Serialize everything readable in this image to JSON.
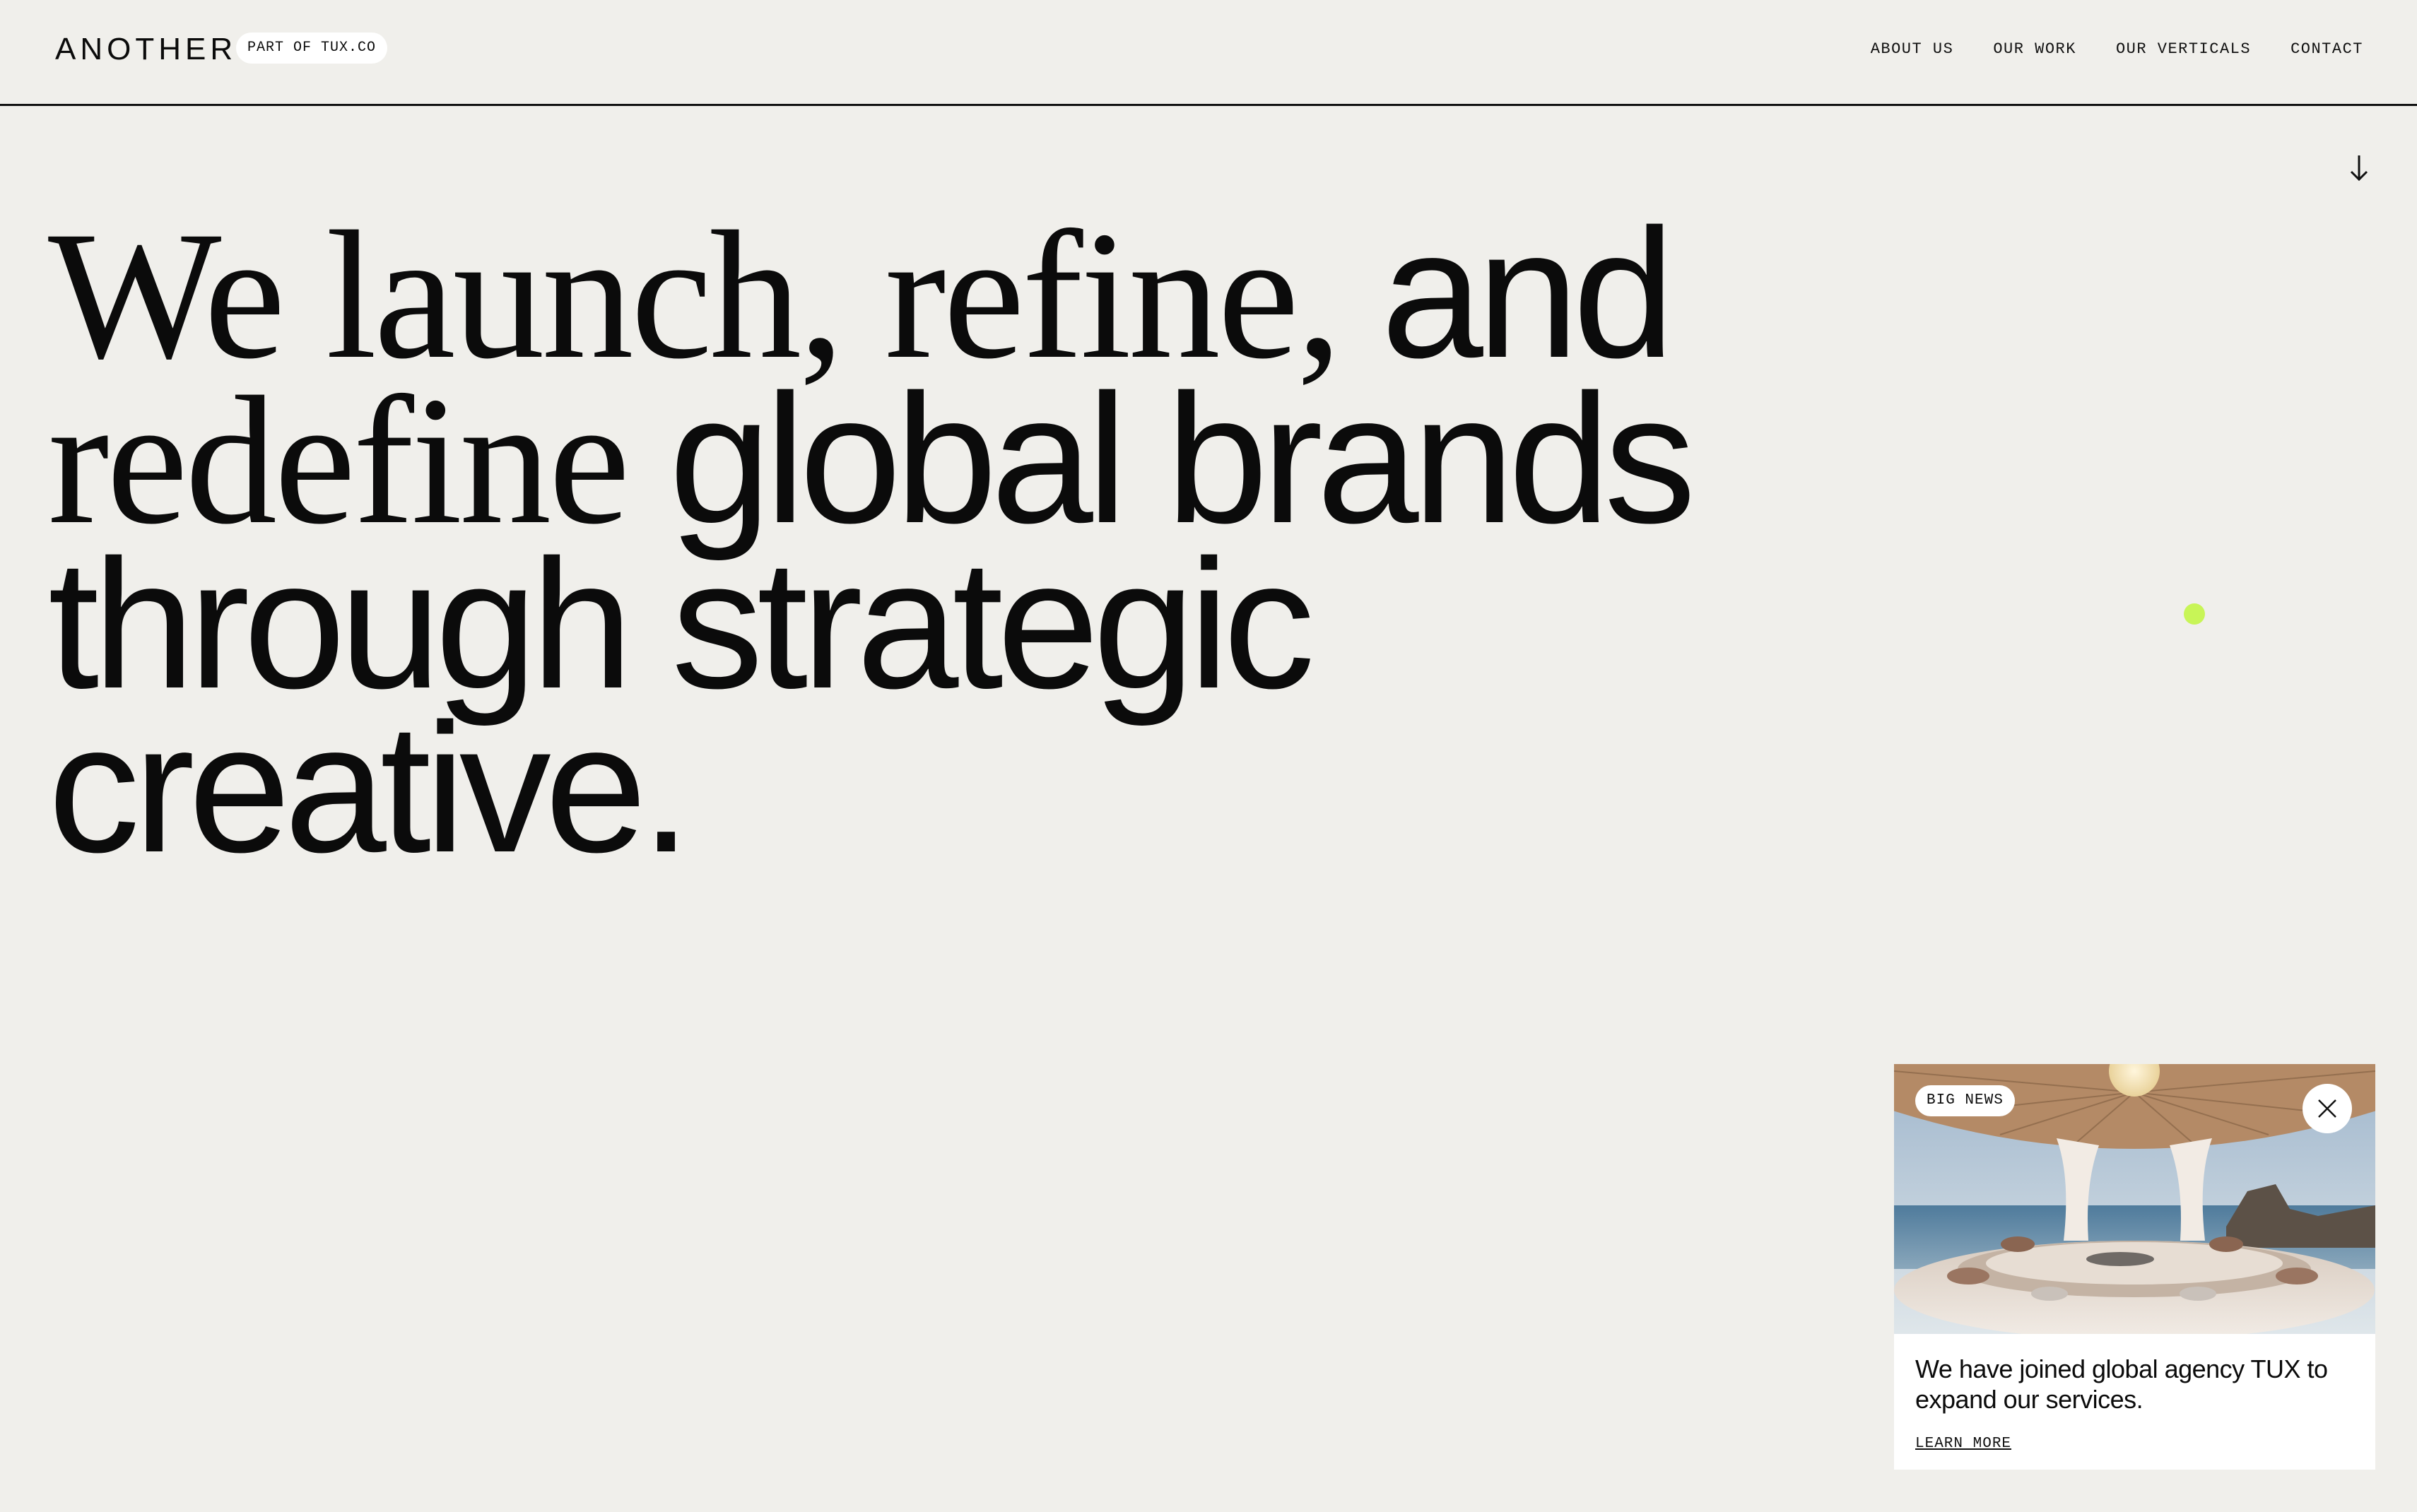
{
  "header": {
    "logo": "ANOTHER",
    "badge": "PART OF TUX.CO",
    "nav": [
      {
        "label": "ABOUT US"
      },
      {
        "label": "OUR WORK"
      },
      {
        "label": "OUR VERTICALS"
      },
      {
        "label": "CONTACT"
      }
    ]
  },
  "hero": {
    "line1": {
      "serif": "We launch, refine,",
      "sans": "and"
    },
    "line2": {
      "serif": "redefine",
      "sans": "global brands"
    },
    "line3": {
      "sans": "through strategic"
    },
    "line4": {
      "sans": "creative."
    }
  },
  "news_card": {
    "tag": "BIG NEWS",
    "text": "We have joined global agency TUX to expand our services.",
    "link": "LEARN MORE"
  },
  "colors": {
    "background": "#f0efeb",
    "text": "#0b0b0b",
    "accent_dot": "#c8f557"
  },
  "icons": [
    "arrow-down-icon",
    "close-icon"
  ]
}
